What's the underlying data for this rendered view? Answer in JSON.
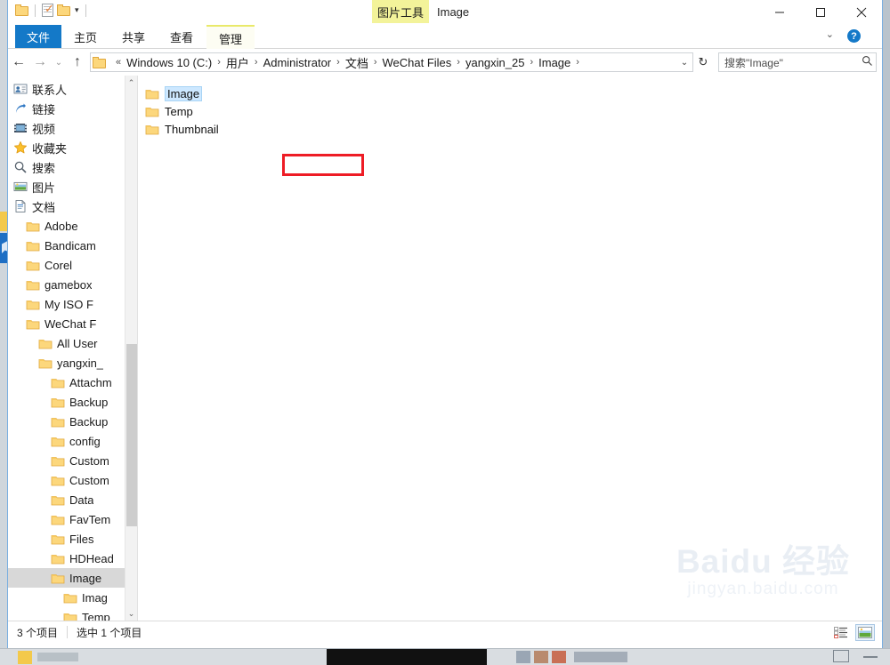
{
  "window": {
    "title": "Image",
    "context_tool_tab": "图片工具",
    "minimize_label": "最小化",
    "maximize_label": "最大化",
    "close_label": "关闭",
    "ribbon_collapse_label": "折叠功能区",
    "help_label": "?"
  },
  "quick_access": {
    "items": [
      {
        "name": "new-folder-icon",
        "label": "新建文件夹"
      },
      {
        "name": "properties-icon",
        "label": "属性"
      },
      {
        "name": "folder-icon",
        "label": "文件夹"
      },
      {
        "name": "customize-qat-caret",
        "label": "▾"
      }
    ]
  },
  "ribbon": {
    "tabs": [
      {
        "label": "文件",
        "active": true
      },
      {
        "label": "主页",
        "active": false
      },
      {
        "label": "共享",
        "active": false
      },
      {
        "label": "查看",
        "active": false
      },
      {
        "label": "管理",
        "active": false
      }
    ]
  },
  "addressbar": {
    "back": "←",
    "forward": "→",
    "recent": "⌄",
    "up": "↑",
    "overflow": "«",
    "crumbs": [
      "Windows 10 (C:)",
      "用户",
      "Administrator",
      "文档",
      "WeChat Files",
      "yangxin_25",
      "Image"
    ],
    "separator": "›",
    "dropdown": "⌄",
    "refresh": "↻",
    "refresh_label": "刷新"
  },
  "search": {
    "placeholder": "搜索\"Image\"",
    "value": "搜索\"Image\"",
    "icon": "search-icon"
  },
  "sidebar": {
    "scroll_up": "⌃",
    "scroll_down": "⌄",
    "items": [
      {
        "label": "联系人",
        "icon": "contacts-icon",
        "indent": 0,
        "selected": false
      },
      {
        "label": "链接",
        "icon": "links-icon",
        "indent": 0,
        "selected": false
      },
      {
        "label": "视频",
        "icon": "videos-icon",
        "indent": 0,
        "selected": false
      },
      {
        "label": "收藏夹",
        "icon": "favorites-star-icon",
        "indent": 0,
        "selected": false
      },
      {
        "label": "搜索",
        "icon": "search-icon",
        "indent": 0,
        "selected": false
      },
      {
        "label": "图片",
        "icon": "pictures-icon",
        "indent": 0,
        "selected": false
      },
      {
        "label": "文档",
        "icon": "documents-icon",
        "indent": 0,
        "selected": false
      },
      {
        "label": "Adobe",
        "icon": "folder-icon",
        "indent": 1,
        "selected": false
      },
      {
        "label": "Bandicam",
        "icon": "folder-icon",
        "indent": 1,
        "selected": false
      },
      {
        "label": "Corel",
        "icon": "folder-icon",
        "indent": 1,
        "selected": false
      },
      {
        "label": "gamebox",
        "icon": "folder-icon",
        "indent": 1,
        "selected": false
      },
      {
        "label": "My ISO F",
        "icon": "folder-icon",
        "indent": 1,
        "selected": false
      },
      {
        "label": "WeChat F",
        "icon": "folder-icon",
        "indent": 1,
        "selected": false
      },
      {
        "label": "All User",
        "icon": "folder-icon",
        "indent": 2,
        "selected": false
      },
      {
        "label": "yangxin_",
        "icon": "folder-icon",
        "indent": 2,
        "selected": false
      },
      {
        "label": "Attachm",
        "icon": "folder-icon",
        "indent": 3,
        "selected": false
      },
      {
        "label": "Backup",
        "icon": "folder-icon",
        "indent": 3,
        "selected": false
      },
      {
        "label": "Backup",
        "icon": "folder-icon",
        "indent": 3,
        "selected": false
      },
      {
        "label": "config",
        "icon": "folder-icon",
        "indent": 3,
        "selected": false
      },
      {
        "label": "Custom",
        "icon": "folder-icon",
        "indent": 3,
        "selected": false
      },
      {
        "label": "Custom",
        "icon": "folder-icon",
        "indent": 3,
        "selected": false
      },
      {
        "label": "Data",
        "icon": "folder-icon",
        "indent": 3,
        "selected": false
      },
      {
        "label": "FavTem",
        "icon": "folder-icon",
        "indent": 3,
        "selected": false
      },
      {
        "label": "Files",
        "icon": "folder-icon",
        "indent": 3,
        "selected": false
      },
      {
        "label": "HDHead",
        "icon": "folder-icon",
        "indent": 3,
        "selected": false
      },
      {
        "label": "Image",
        "icon": "folder-icon",
        "indent": 3,
        "selected": true
      },
      {
        "label": "Imag",
        "icon": "folder-icon",
        "indent": 4,
        "selected": false
      },
      {
        "label": "Temp",
        "icon": "folder-icon",
        "indent": 4,
        "selected": false
      }
    ]
  },
  "content": {
    "items": [
      {
        "name": "Image",
        "icon": "folder-icon",
        "selected": true
      },
      {
        "name": "Temp",
        "icon": "folder-icon",
        "selected": false
      },
      {
        "name": "Thumbnail",
        "icon": "folder-icon",
        "selected": false
      }
    ],
    "highlight_target": "Image"
  },
  "statusbar": {
    "item_count": "3 个项目",
    "selection": "选中 1 个项目",
    "views": [
      {
        "name": "details-view-button",
        "label": "详细信息",
        "active": false
      },
      {
        "name": "large-icons-view-button",
        "label": "大图标",
        "active": true
      }
    ]
  },
  "watermark": {
    "line1": "Baidu 经验",
    "line2": "jingyan.baidu.com"
  }
}
